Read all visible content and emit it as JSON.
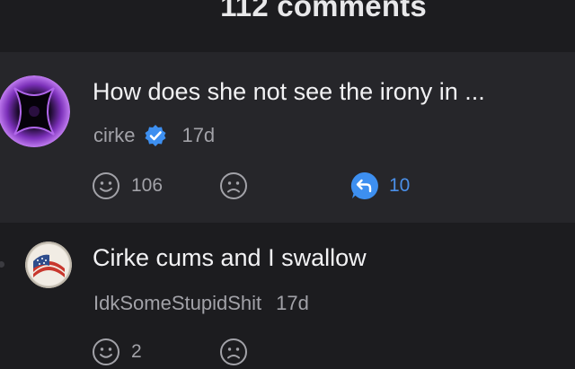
{
  "header": {
    "title": "112 comments"
  },
  "comments": [
    {
      "text": "How does she not see the irony in ...",
      "author": "cirke",
      "verified": true,
      "time": "17d",
      "likes": "106",
      "replies": "10",
      "avatar_icon": "purple-abstract-avatar",
      "highlighted": true
    },
    {
      "text": "Cirke cums and I swallow",
      "author": "IdkSomeStupidShit",
      "verified": false,
      "time": "17d",
      "likes": "2",
      "avatar_icon": "flag-avatar",
      "highlighted": false
    }
  ],
  "colors": {
    "background": "#1c1c1f",
    "highlight_background": "#26262a",
    "accent_blue": "#4a8fe8",
    "text_primary": "#f2f2f4",
    "text_secondary": "#a2a2a8"
  },
  "icons": {
    "like": "smile-face-icon",
    "dislike": "frown-face-icon",
    "reply": "reply-bubble-icon",
    "verified": "verified-badge-icon"
  }
}
